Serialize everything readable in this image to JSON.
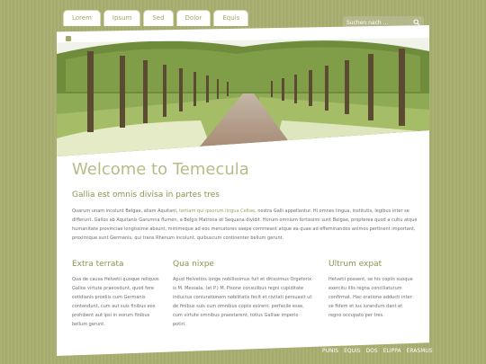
{
  "nav": {
    "tabs": [
      "Lorem",
      "Ipsum",
      "Sed",
      "Dolor",
      "Equis"
    ]
  },
  "search": {
    "placeholder": "Suchen nach ..."
  },
  "main": {
    "title": "Welcome to Temecula",
    "subtitle": "Gallia est omnis divisa in partes tres",
    "intro_a": "Quarum unam incolunt Belgae, aliam Aquitani, ",
    "intro_highlight": "tertiam qui ipsorum lingua Celtae",
    "intro_b": ", nostra Galli appellantur. Hi omnes lingua, institutis, legibus inter se differunt. Gallos ab Aquitanis Garumna flumen, a Belgis Matrona et Sequana dividit. Horum omnium fortissimi sunt Belgae, propterea quod a cultu atque humanitate provinciae longissime absunt, minimeque ad eos mercatores saepe commeant atque ea quae ad effeminandos animos pertinent important, proximique sunt Germanis, qui trans Rhenum incolunt, quibuscum continenter bellum gerunt."
  },
  "columns": [
    {
      "title": "Extra terrata",
      "text": "Qua de causa Helvetii quoque reliquos Gallos virtute praecedunt, quod fere cotidianis proeliis cum Germanis contendunt, cum aut suis finibus eos prohibent aut ipsi in eorum finibus bellum gerunt."
    },
    {
      "title": "Qua nixpe",
      "text": "Apud Helvetios longe nobilissimus fuit et ditissimus Orgetorix is M. Messala, (et P.) M. Pisone consulibus regni cupiditate inductus coniurationem nobilitatis fecit et civitati persuasit ut de finibus suis cum omnibus copiis exirent: perfacile esse, cum virtute omnibus praestarent, totius Galliae imperio potiri."
    },
    {
      "title": "Ultrum expat",
      "text": "Helvetii possent, se his copiis suoque exercitu illis regna conciliaturum confirmat. Hac oratione adducti inter se fidem et ius iurandum dant et regno occupato per tres."
    }
  ],
  "footer": {
    "links": [
      "PUNIS",
      "EQUIS",
      "DOS",
      "ELIPPA",
      "ERASMUS"
    ]
  }
}
